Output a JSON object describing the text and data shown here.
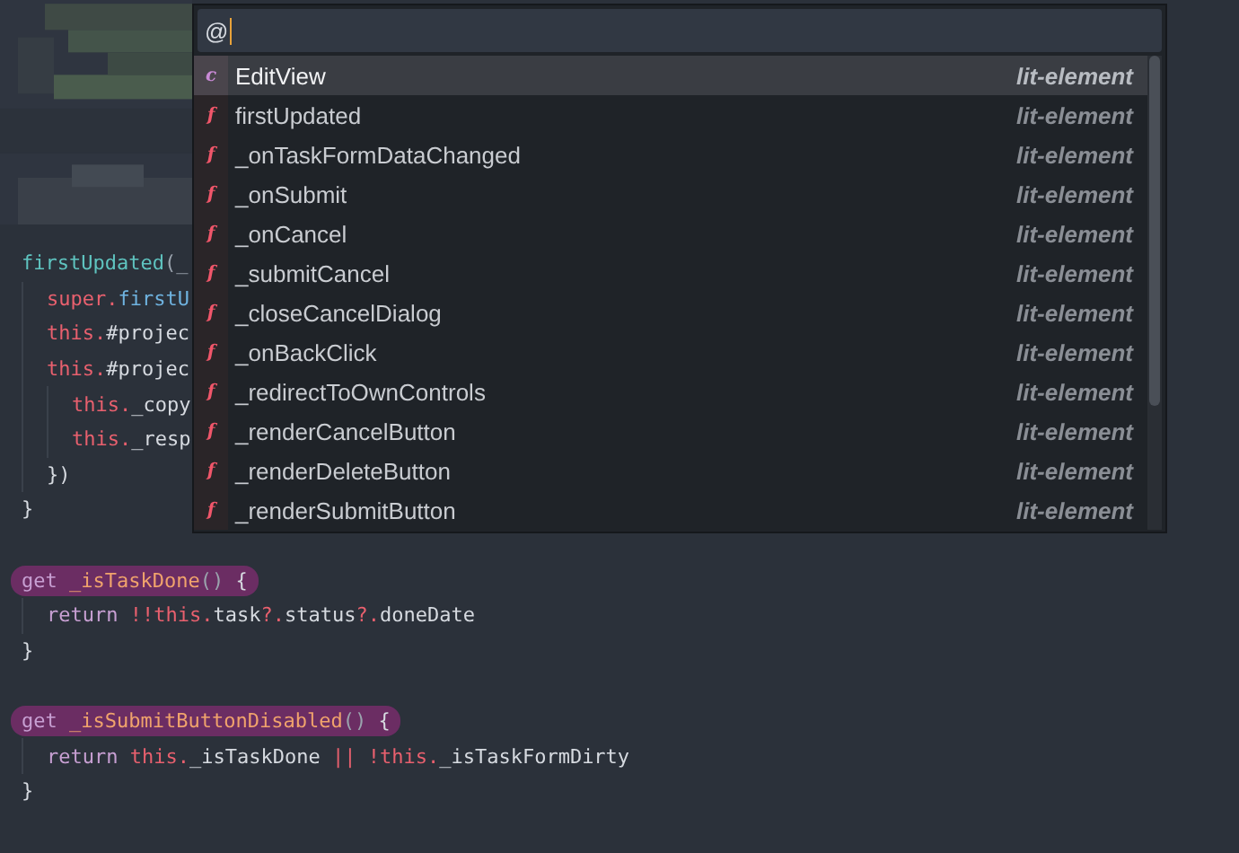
{
  "editor": {
    "blocks": [
      {
        "lines": [
          {
            "highlighted": false,
            "tokens": [
              {
                "text": "firstUpdated",
                "kind": "fn"
              },
              {
                "text": "(_",
                "kind": "punct"
              }
            ],
            "children": [
              {
                "highlighted": false,
                "tokens": [
                  {
                    "text": "super.",
                    "kind": "kw"
                  },
                  {
                    "text": "firstU",
                    "kind": "call"
                  }
                ]
              },
              {
                "highlighted": false,
                "tokens": [
                  {
                    "text": "this.",
                    "kind": "kw"
                  },
                  {
                    "text": "#projec",
                    "kind": "plain"
                  }
                ]
              },
              {
                "highlighted": false,
                "tokens": [
                  {
                    "text": "this.",
                    "kind": "kw"
                  },
                  {
                    "text": "#projec",
                    "kind": "plain"
                  }
                ],
                "children": [
                  {
                    "highlighted": false,
                    "tokens": [
                      {
                        "text": "this.",
                        "kind": "kw"
                      },
                      {
                        "text": "_copy",
                        "kind": "plain"
                      }
                    ]
                  },
                  {
                    "highlighted": false,
                    "tokens": [
                      {
                        "text": "this.",
                        "kind": "kw"
                      },
                      {
                        "text": "_resp",
                        "kind": "plain"
                      }
                    ]
                  }
                ]
              },
              {
                "highlighted": false,
                "tokens": [
                  {
                    "text": "})",
                    "kind": "plain"
                  }
                ]
              }
            ]
          },
          {
            "highlighted": false,
            "tokens": [
              {
                "text": "}",
                "kind": "plain"
              }
            ]
          }
        ]
      },
      {
        "lines": [
          {
            "highlighted": true,
            "tokens": [
              {
                "text": "get ",
                "kind": "get"
              },
              {
                "text": "_isTaskDone",
                "kind": "name"
              },
              {
                "text": "() ",
                "kind": "punct"
              },
              {
                "text": "{",
                "kind": "plain"
              }
            ],
            "children": [
              {
                "highlighted": false,
                "tokens": [
                  {
                    "text": "return ",
                    "kind": "get"
                  },
                  {
                    "text": "!!this.",
                    "kind": "kw"
                  },
                  {
                    "text": "task",
                    "kind": "plain"
                  },
                  {
                    "text": "?.",
                    "kind": "kw"
                  },
                  {
                    "text": "status",
                    "kind": "plain"
                  },
                  {
                    "text": "?.",
                    "kind": "kw"
                  },
                  {
                    "text": "doneDate",
                    "kind": "plain"
                  }
                ]
              }
            ]
          },
          {
            "highlighted": false,
            "tokens": [
              {
                "text": "}",
                "kind": "plain"
              }
            ]
          }
        ]
      },
      {
        "lines": [
          {
            "highlighted": true,
            "tokens": [
              {
                "text": "get ",
                "kind": "get"
              },
              {
                "text": "_isSubmitButtonDisabled",
                "kind": "name"
              },
              {
                "text": "() ",
                "kind": "punct"
              },
              {
                "text": "{",
                "kind": "plain"
              }
            ],
            "children": [
              {
                "highlighted": false,
                "tokens": [
                  {
                    "text": "return ",
                    "kind": "get"
                  },
                  {
                    "text": "this.",
                    "kind": "kw"
                  },
                  {
                    "text": "_isTaskDone ",
                    "kind": "plain"
                  },
                  {
                    "text": "|| ",
                    "kind": "kw"
                  },
                  {
                    "text": "!this.",
                    "kind": "kw"
                  },
                  {
                    "text": "_isTaskFormDirty",
                    "kind": "plain"
                  }
                ]
              }
            ]
          },
          {
            "highlighted": false,
            "tokens": [
              {
                "text": "}",
                "kind": "plain"
              }
            ]
          }
        ]
      }
    ]
  },
  "palette": {
    "query": "@",
    "items": [
      {
        "kind": "class",
        "badge": "c",
        "name": "EditView",
        "source": "lit-element",
        "selected": true
      },
      {
        "kind": "function",
        "badge": "f",
        "name": "firstUpdated",
        "source": "lit-element",
        "selected": false
      },
      {
        "kind": "function",
        "badge": "f",
        "name": "_onTaskFormDataChanged",
        "source": "lit-element",
        "selected": false
      },
      {
        "kind": "function",
        "badge": "f",
        "name": "_onSubmit",
        "source": "lit-element",
        "selected": false
      },
      {
        "kind": "function",
        "badge": "f",
        "name": "_onCancel",
        "source": "lit-element",
        "selected": false
      },
      {
        "kind": "function",
        "badge": "f",
        "name": "_submitCancel",
        "source": "lit-element",
        "selected": false
      },
      {
        "kind": "function",
        "badge": "f",
        "name": "_closeCancelDialog",
        "source": "lit-element",
        "selected": false
      },
      {
        "kind": "function",
        "badge": "f",
        "name": "_onBackClick",
        "source": "lit-element",
        "selected": false
      },
      {
        "kind": "function",
        "badge": "f",
        "name": "_redirectToOwnControls",
        "source": "lit-element",
        "selected": false
      },
      {
        "kind": "function",
        "badge": "f",
        "name": "_renderCancelButton",
        "source": "lit-element",
        "selected": false
      },
      {
        "kind": "function",
        "badge": "f",
        "name": "_renderDeleteButton",
        "source": "lit-element",
        "selected": false
      },
      {
        "kind": "function",
        "badge": "f",
        "name": "_renderSubmitButton",
        "source": "lit-element",
        "selected": false
      }
    ]
  }
}
